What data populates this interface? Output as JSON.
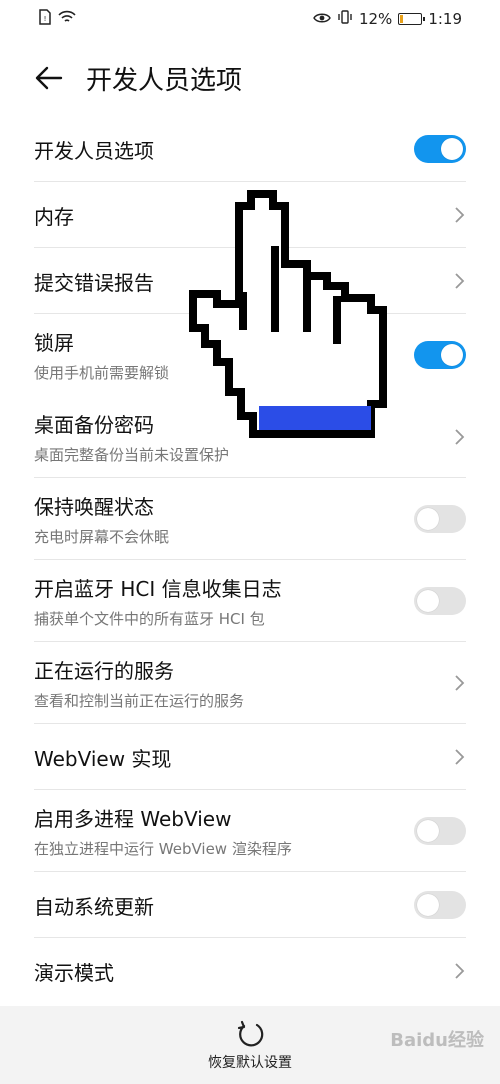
{
  "status": {
    "battery_pct": "12%",
    "time": "1:19"
  },
  "header": {
    "title": "开发人员选项"
  },
  "rows": [
    {
      "title": "开发人员选项",
      "toggle": true
    },
    {
      "title": "内存"
    },
    {
      "title": "提交错误报告"
    },
    {
      "title": "锁屏",
      "subtitle": "使用手机前需要解锁",
      "toggle": true
    },
    {
      "title": "桌面备份密码",
      "subtitle": "桌面完整备份当前未设置保护"
    },
    {
      "title": "保持唤醒状态",
      "subtitle": "充电时屏幕不会休眠",
      "toggle": false
    },
    {
      "title": "开启蓝牙 HCI 信息收集日志",
      "subtitle": "捕获单个文件中的所有蓝牙 HCI 包",
      "toggle": false
    },
    {
      "title": "正在运行的服务",
      "subtitle": "查看和控制当前正在运行的服务"
    },
    {
      "title": "WebView 实现"
    },
    {
      "title": "启用多进程 WebView",
      "subtitle": "在独立进程中运行 WebView 渲染程序",
      "toggle": false
    },
    {
      "title": "自动系统更新",
      "toggle": false
    },
    {
      "title": "演示模式"
    }
  ],
  "bottom": {
    "reset_label": "恢复默认设置"
  },
  "watermark": "Baidu经验",
  "colors": {
    "accent": "#1295ee",
    "battery": "#e8a11b"
  }
}
